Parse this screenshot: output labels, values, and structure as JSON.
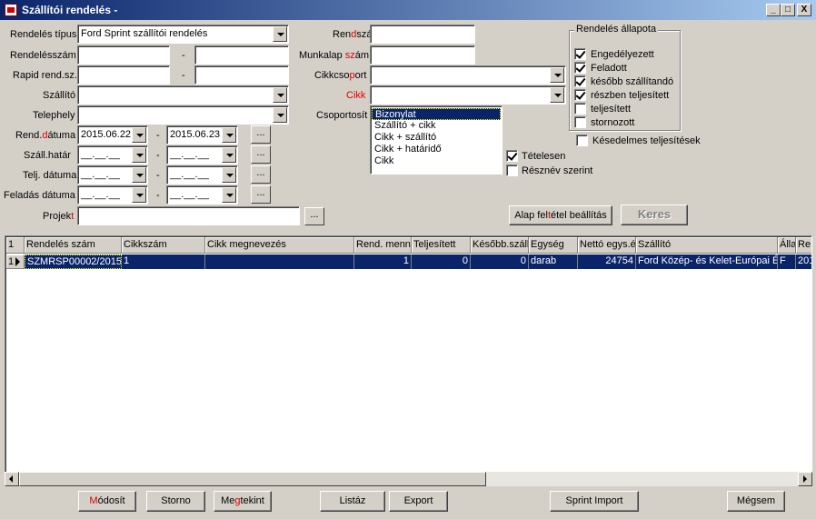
{
  "window": {
    "title": "Szállítói rendelés -",
    "minimize": "_",
    "maximize": "□",
    "close": "X"
  },
  "labels": {
    "rendeles_tipus": "Rendelés típus",
    "rendelesszam": "Rendelésszám",
    "rapid": "Rapid rend.sz.",
    "szallito": "Szállító",
    "telephely": "Telephely",
    "rend_datum_a": "Rend.",
    "rend_datum_b": "d",
    "rend_datum_c": "átuma",
    "szall_hatar": "Száll.határ",
    "telj_datum": "Telj. dátuma",
    "feladas_datum": "Feladás dátuma",
    "projekt_a": "Projek",
    "projekt_b": "t",
    "rendszam_a": "Ren",
    "rendszam_b": "d",
    "rendszam_c": "szám",
    "munkalap_a": "Munkalap ",
    "munkalap_b": "sz",
    "munkalap_c": "ám",
    "cikkcsoport_a": "Cikkcso",
    "cikkcsoport_b": "p",
    "cikkcsoport_c": "ort",
    "cikk_a": "C",
    "cikk_b": "ikk",
    "csoportosit": "Csoportosít",
    "dash": "-"
  },
  "fields": {
    "rendeles_tipus": "Ford Sprint szállítói rendelés",
    "rend_datum_from": "2015.06.22",
    "rend_datum_to": "2015.06.23",
    "empty_date": "__.__.__",
    "ellipsis": "..."
  },
  "grouping": {
    "items": [
      "Bizonylat",
      "Szállító + cikk",
      "Cikk + szállító",
      "Cikk + határidő",
      "Cikk"
    ],
    "selected": 0
  },
  "checks": {
    "tetelesen": "Tételesen",
    "resznev": "Résznév szerint",
    "kesedelmes": "Késedelmes teljesítések"
  },
  "status_group": {
    "title": "Rendelés állapota",
    "items": [
      {
        "label": "Engedélyezett",
        "checked": true
      },
      {
        "label": "Feladott",
        "checked": true
      },
      {
        "label": "később szállítandó",
        "checked": true
      },
      {
        "label": "részben teljesített",
        "checked": true
      },
      {
        "label": "teljesített",
        "checked": false
      },
      {
        "label": "stornozott",
        "checked": false
      }
    ]
  },
  "buttons": {
    "alap_a": "Alap fel",
    "alap_b": "t",
    "alap_c": "étel beállítás",
    "keres": "Keres",
    "modosit_a": "M",
    "modosit_b": "ódosít",
    "storno": "Storno",
    "megtekint_a": "Me",
    "megtekint_b": "g",
    "megtekint_c": "tekint",
    "listaz": "Listáz",
    "export": "Export",
    "sprint_import": "Sprint Import",
    "megsem": "Mégsem"
  },
  "grid": {
    "corner": "1",
    "columns": [
      "Rendelés szám",
      "Cikkszám",
      "Cikk megnevezés",
      "Rend. menn",
      "Teljesített",
      "Később.száll",
      "Egység",
      "Nettó egys.é",
      "Szállító",
      "Álla",
      "Re"
    ],
    "rows": [
      {
        "num": "1",
        "cells": [
          "SZMRSP00002/2015",
          "1",
          "",
          "1",
          "0",
          "0",
          "darab",
          "24754",
          "Ford Közép- és Kelet-Európai Ér",
          "F",
          "201"
        ]
      }
    ]
  }
}
